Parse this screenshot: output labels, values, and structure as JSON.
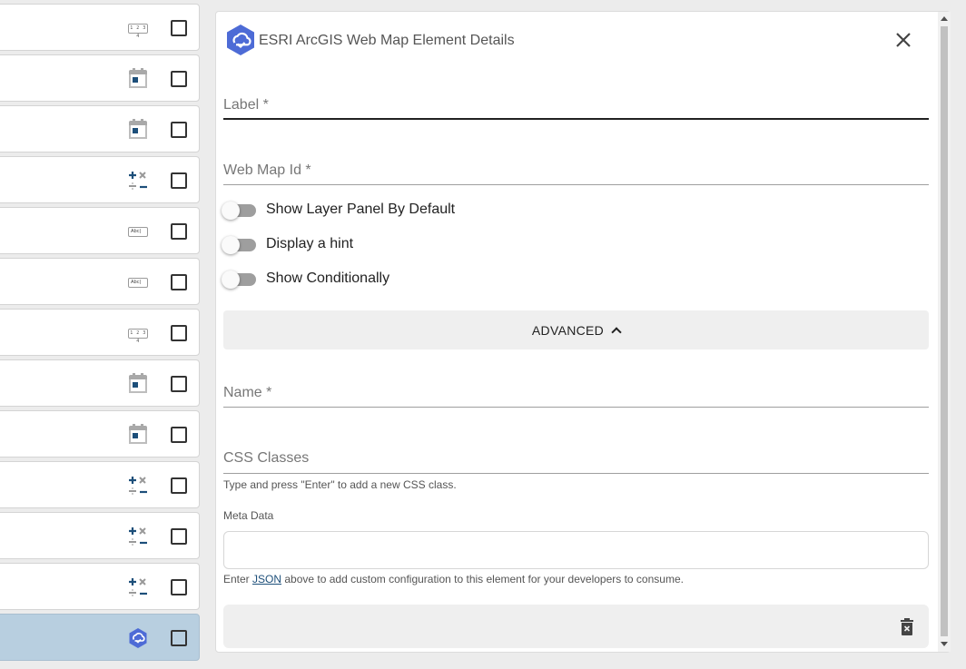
{
  "list": {
    "items": [
      {
        "icon": "number-field-icon",
        "icon_text": "1 2 3 4",
        "selected": false
      },
      {
        "icon": "calendar-icon",
        "selected": false
      },
      {
        "icon": "calendar-icon",
        "selected": false
      },
      {
        "icon": "calculation-icon",
        "selected": false
      },
      {
        "icon": "text-field-icon",
        "icon_text": "Abc|",
        "selected": false
      },
      {
        "icon": "text-field-icon",
        "icon_text": "Abc|",
        "selected": false
      },
      {
        "icon": "number-field-icon",
        "icon_text": "1 2 3 4",
        "selected": false
      },
      {
        "icon": "calendar-icon",
        "selected": false
      },
      {
        "icon": "calendar-icon",
        "selected": false
      },
      {
        "icon": "calculation-icon",
        "selected": false
      },
      {
        "icon": "calculation-icon",
        "selected": false
      },
      {
        "icon": "calculation-icon",
        "selected": false
      },
      {
        "icon": "arcgis-web-map-icon",
        "selected": true
      }
    ]
  },
  "panel": {
    "title": "ESRI ArcGIS Web Map Element Details",
    "label_field": {
      "label": "Label *"
    },
    "webmap_field": {
      "label": "Web Map Id *"
    },
    "toggles": [
      {
        "label": "Show Layer Panel By Default",
        "on": false
      },
      {
        "label": "Display a hint",
        "on": false
      },
      {
        "label": "Show Conditionally",
        "on": false
      }
    ],
    "advanced_label": "ADVANCED",
    "name_field": {
      "label": "Name *"
    },
    "css_field": {
      "label": "CSS Classes",
      "helper": "Type and press \"Enter\" to add a new CSS class."
    },
    "meta": {
      "label": "Meta Data",
      "helper_prefix": "Enter ",
      "helper_link": "JSON",
      "helper_suffix": " above to add custom configuration to this element for your developers to consume."
    }
  },
  "colors": {
    "accent": "#1d4f7a",
    "logo": "#4d6bd6",
    "selected_row": "#b8cfe0"
  }
}
